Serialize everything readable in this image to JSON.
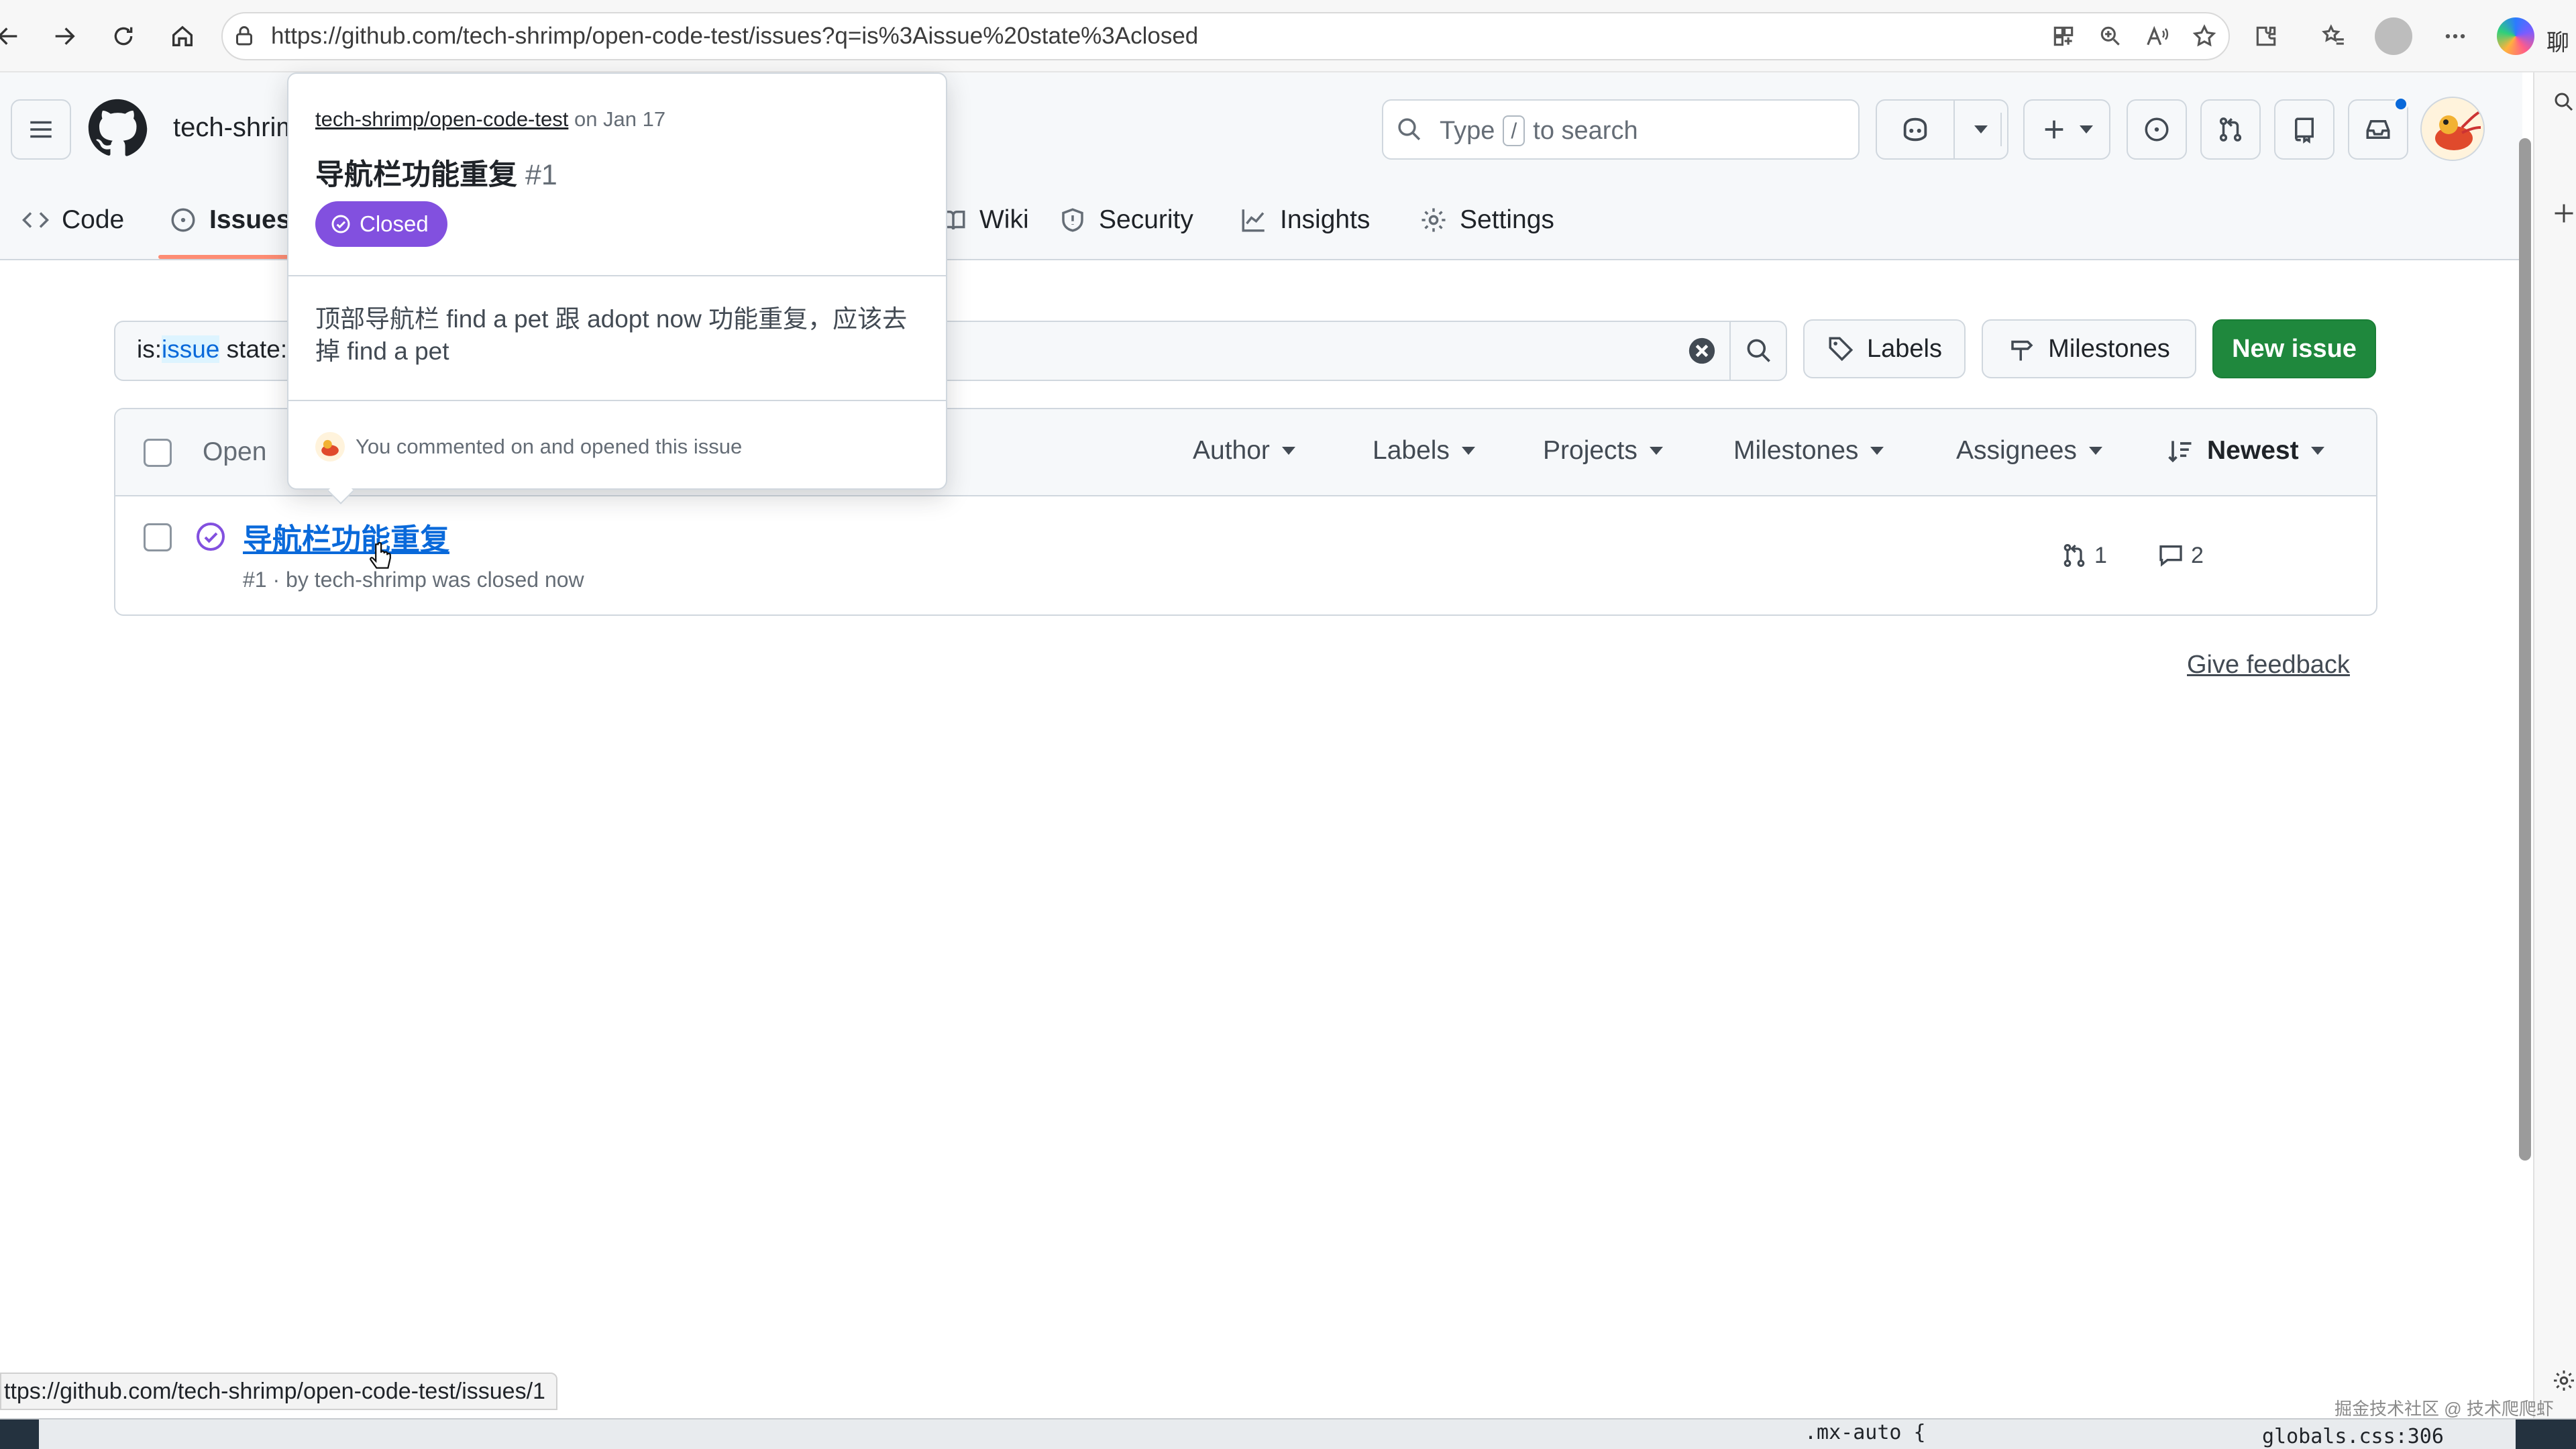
{
  "browser": {
    "url": "https://github.com/tech-shrimp/open-code-test/issues?q=is%3Aissue%20state%3Aclosed",
    "side_label": "聊"
  },
  "header": {
    "owner": "tech-shrim",
    "search_prefix": "Type",
    "search_key": "/",
    "search_suffix": "to search"
  },
  "repo_tabs": {
    "code": "Code",
    "issues": "Issues",
    "wiki": "Wiki",
    "security": "Security",
    "insights": "Insights",
    "settings": "Settings"
  },
  "toolbar": {
    "filter_prefix": "is:",
    "filter_highlight": "issue",
    "filter_rest": " state:",
    "labels_button": "Labels",
    "milestones_button": "Milestones",
    "new_issue_button": "New issue"
  },
  "list_header": {
    "open_label": "Open",
    "filters": {
      "author": "Author",
      "labels": "Labels",
      "projects": "Projects",
      "milestones": "Milestones",
      "assignees": "Assignees",
      "sort": "Newest"
    }
  },
  "issues": [
    {
      "title": "导航栏功能重复",
      "meta": "#1 · by tech-shrimp was closed now",
      "linked_prs": "1",
      "comments": "2"
    }
  ],
  "give_feedback": "Give feedback",
  "hovercard": {
    "repo": "tech-shrimp/open-code-test",
    "date": " on Jan 17",
    "title": "导航栏功能重复",
    "number": "#1",
    "state": "Closed",
    "body": "顶部导航栏 find a pet 跟 adopt now 功能重复，应该去掉 find a pet",
    "footer": "You commented on and opened this issue"
  },
  "status_bar": {
    "link_url": "ttps://github.com/tech-shrimp/open-code-test/issues/1",
    "devtools_selector": ".mx-auto {",
    "devtools_source": "globals.css:306",
    "watermark": "掘金技术社区 @ 技术爬爬虾"
  },
  "colors": {
    "primary_green": "#1f883d",
    "closed_purple": "#8250df",
    "link_blue": "#0969da",
    "tab_underline": "#fd8c73"
  }
}
